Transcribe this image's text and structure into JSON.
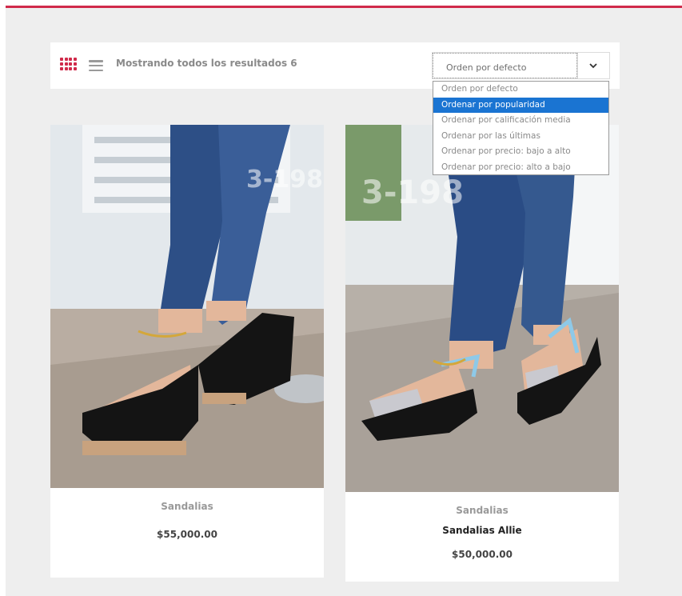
{
  "colors": {
    "accent": "#d02a4a",
    "background": "#eeeeee",
    "dropdown_highlight": "#1a74d2"
  },
  "toolbar": {
    "grid_view_icon": "grid-view-icon",
    "list_view_icon": "list-view-icon",
    "result_count": "Mostrando todos los resultados 6",
    "sort": {
      "selected": "Orden por defecto",
      "chevron_icon": "chevron-down-icon",
      "options": [
        "Orden por defecto",
        "Ordenar por popularidad",
        "Ordenar por calificación media",
        "Ordenar por las últimas",
        "Ordenar por precio: bajo a alto",
        "Ordenar por precio: alto a bajo"
      ],
      "highlighted_index": 1
    }
  },
  "products": [
    {
      "watermark": "3-198",
      "category": "Sandalias",
      "title": "",
      "price": "$55,000.00"
    },
    {
      "watermark": "3-198",
      "category": "Sandalias",
      "title": "Sandalias Allie",
      "price": "$50,000.00"
    }
  ]
}
